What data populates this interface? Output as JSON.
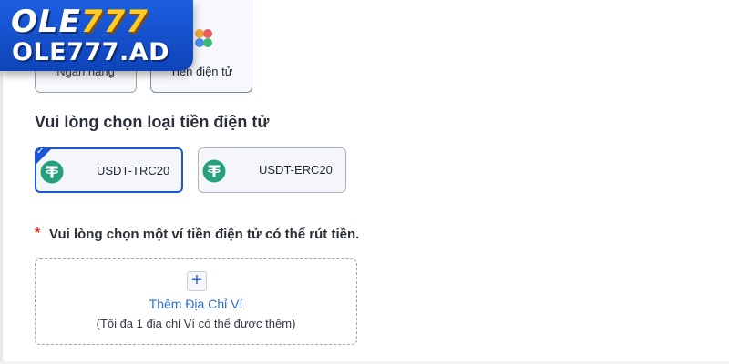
{
  "logo": {
    "top_ole": "OLE",
    "top_777": "777",
    "bottom": "OLE777.AD"
  },
  "methods": {
    "bank_label": "Ngân hàng",
    "crypto_label": "Tiền điện tử"
  },
  "crypto": {
    "section_title": "Vui lòng chọn loại tiền điện tử",
    "tokens": [
      {
        "label": "USDT-TRC20",
        "selected": true
      },
      {
        "label": "USDT-ERC20",
        "selected": false
      }
    ],
    "check": "✓",
    "accent": "#1e57d6",
    "tether_color": "#26a17b"
  },
  "wallet": {
    "required_marker": "*",
    "title": "Vui lòng chọn một ví tiền điện tử có thể rút tiền.",
    "add_icon": "plus-icon",
    "plus_symbol": "+",
    "add_label": "Thêm Địa Chỉ Ví",
    "add_note": "(Tối đa 1 địa chỉ Ví có thể được thêm)"
  }
}
